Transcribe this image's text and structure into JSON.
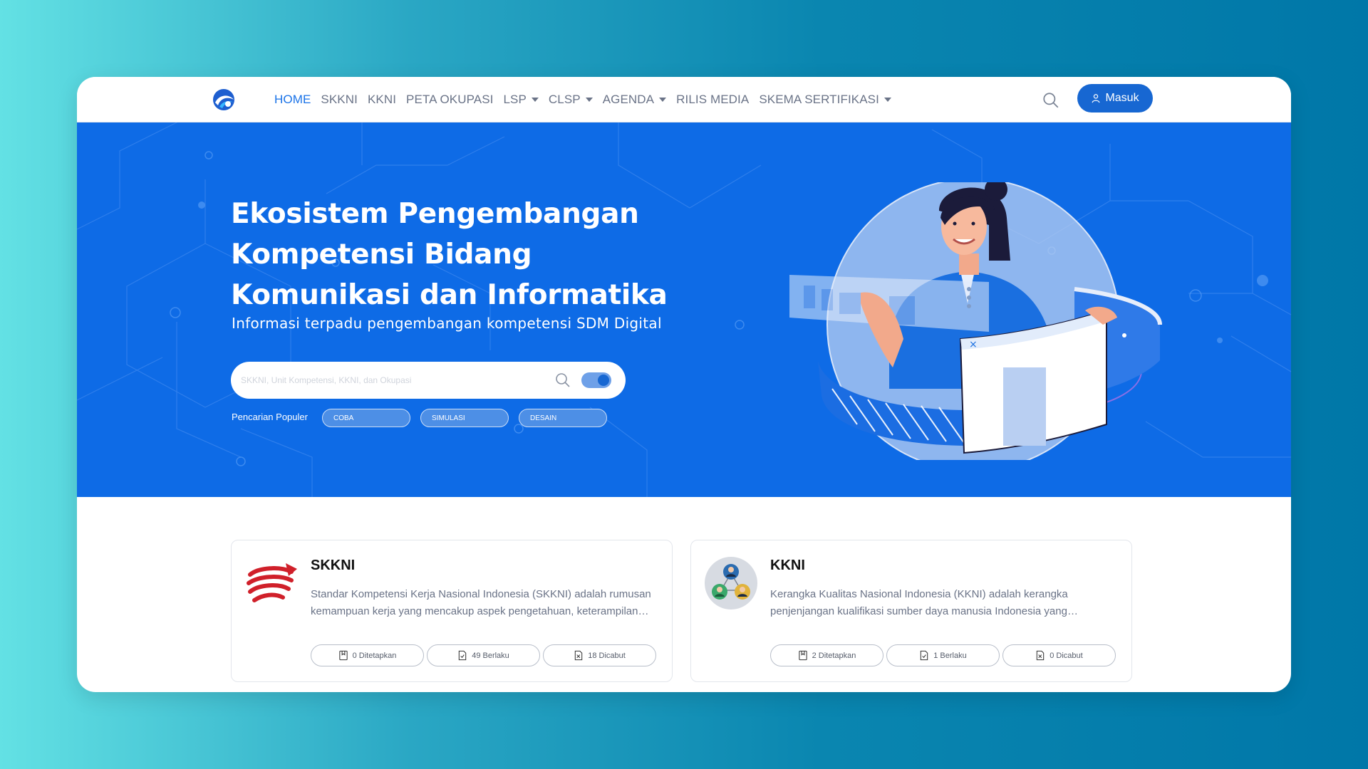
{
  "nav": {
    "items": [
      {
        "label": "HOME",
        "active": true,
        "dropdown": false
      },
      {
        "label": "SKKNI",
        "active": false,
        "dropdown": false
      },
      {
        "label": "KKNI",
        "active": false,
        "dropdown": false
      },
      {
        "label": "PETA OKUPASI",
        "active": false,
        "dropdown": false
      },
      {
        "label": "LSP",
        "active": false,
        "dropdown": true
      },
      {
        "label": "CLSP",
        "active": false,
        "dropdown": true
      },
      {
        "label": "AGENDA",
        "active": false,
        "dropdown": true
      },
      {
        "label": "RILIS MEDIA",
        "active": false,
        "dropdown": false
      },
      {
        "label": "SKEMA SERTIFIKASI",
        "active": false,
        "dropdown": true
      }
    ],
    "login_label": "Masuk",
    "search_icon": "search-icon",
    "login_icon": "user-icon"
  },
  "hero": {
    "title": "Ekosistem Pengembangan Kompetensi Bidang Komunikasi dan Informatika",
    "subtitle": "Informasi terpadu pengembangan kompetensi SDM Digital",
    "search_placeholder": "SKKNI, Unit Kompetensi, KKNI, dan Okupasi",
    "search_value": "",
    "toggle_on": true,
    "popular_label": "Pencarian Populer",
    "popular_chips": [
      "COBA",
      "SIMULASI",
      "DESAIN"
    ]
  },
  "cards": [
    {
      "title": "SKKNI",
      "icon": "skkni-logo-icon",
      "description": "Standar Kompetensi Kerja Nasional Indonesia (SKKNI) adalah rumusan kemampuan kerja yang mencakup aspek pengetahuan, keterampilan dan/atau keahlian serta sikap kerja yang relevan",
      "stats": [
        {
          "label": "0 Ditetapkan",
          "icon": "document-stamp-icon"
        },
        {
          "label": "49 Berlaku",
          "icon": "document-check-icon"
        },
        {
          "label": "18 Dicabut",
          "icon": "document-x-icon"
        }
      ]
    },
    {
      "title": "KKNI",
      "icon": "people-network-icon",
      "description": "Kerangka Kualitas Nasional Indonesia (KKNI) adalah kerangka penjenjangan kualifikasi sumber daya manusia Indonesia yang menyandingkan, menyetarakan, dan mengintegrasikan",
      "stats": [
        {
          "label": "2 Ditetapkan",
          "icon": "document-stamp-icon"
        },
        {
          "label": "1 Berlaku",
          "icon": "document-check-icon"
        },
        {
          "label": "0 Dicabut",
          "icon": "document-x-icon"
        }
      ]
    }
  ],
  "colors": {
    "primary": "#1767d2",
    "hero_bg": "#0e6be6",
    "nav_active": "#1a73e8",
    "nav_text": "#6a7387"
  }
}
